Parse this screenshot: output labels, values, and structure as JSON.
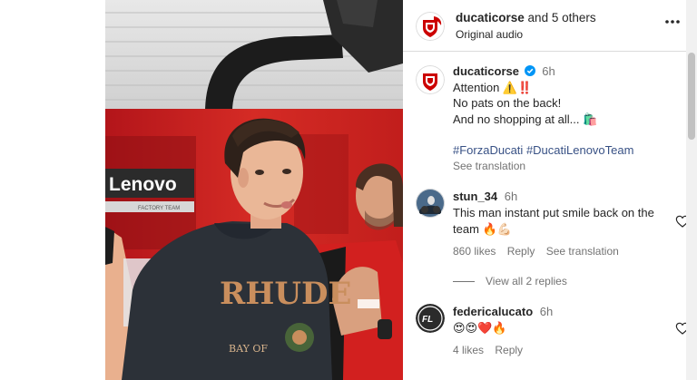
{
  "header": {
    "username": "ducaticorse",
    "others": "and 5 others",
    "audio": "Original audio",
    "more_icon": "more-horizontal-icon"
  },
  "photo": {
    "sponsor_text": "Lenovo",
    "sponsor_sub": "FACTORY TEAM",
    "hoodie_text": "RHUDE",
    "hoodie_sub": "BAY OF"
  },
  "caption": {
    "username": "ducaticorse",
    "time": "6h",
    "line1": "Attention ⚠️‼️",
    "line2": "No pats on the back!",
    "line3": "And no shopping at all... 🛍️",
    "hashtags": [
      "#ForzaDucati",
      "#DucatiLenovoTeam"
    ],
    "see_translation": "See translation"
  },
  "comments": [
    {
      "username": "stun_34",
      "time": "6h",
      "text": "This man instant put smile back on the team 🔥💪🏻",
      "likes": "860 likes",
      "reply": "Reply",
      "see_translation": "See translation"
    },
    {
      "username": "federicalucato",
      "time": "6h",
      "text": "😍😍❤️🔥",
      "likes": "4 likes",
      "reply": "Reply"
    }
  ],
  "view_replies": "View all 2 replies",
  "colors": {
    "ducati_red": "#cc0000",
    "verified_blue": "#0095f6",
    "link_blue": "#385185",
    "muted": "#737373"
  }
}
